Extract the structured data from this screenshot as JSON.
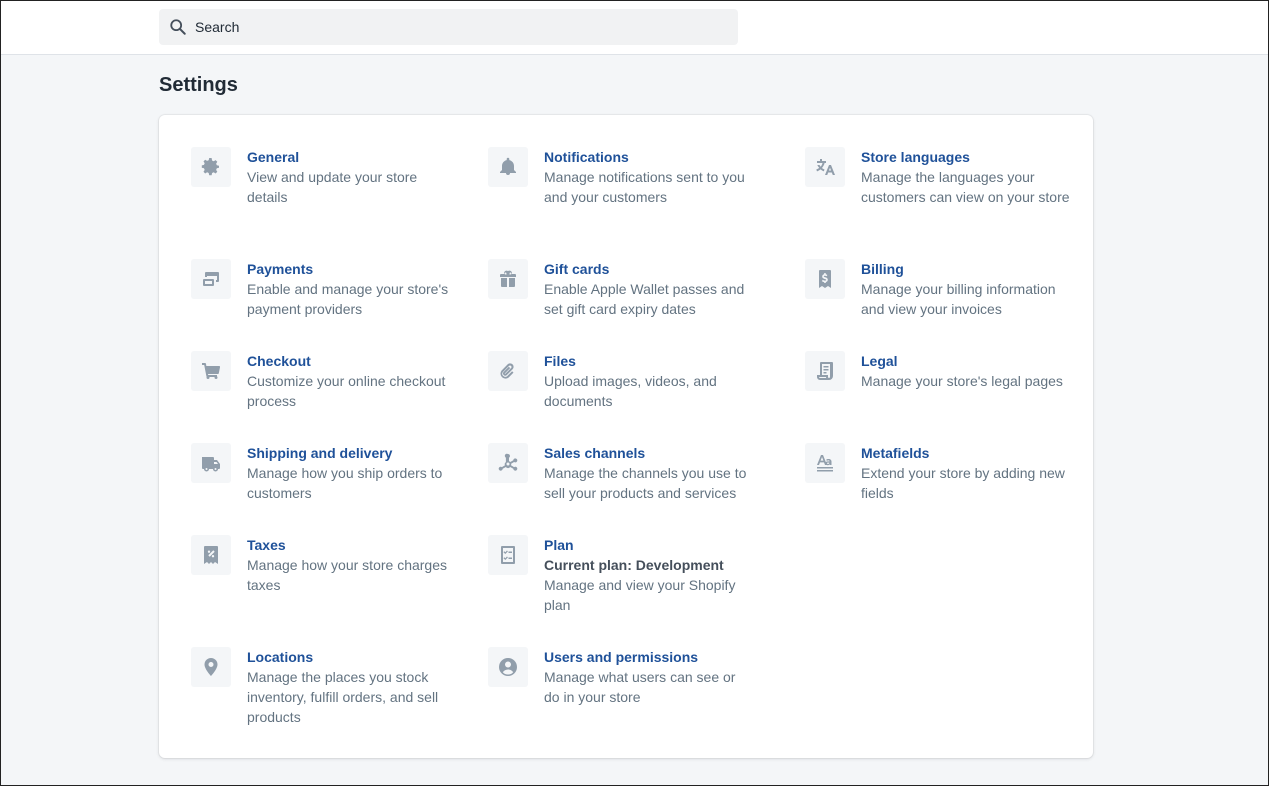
{
  "search": {
    "placeholder": "Search"
  },
  "page": {
    "title": "Settings"
  },
  "settings": [
    {
      "id": "general",
      "icon": "gear-icon",
      "title": "General",
      "description": "View and update your store details"
    },
    {
      "id": "notifications",
      "icon": "bell-icon",
      "title": "Notifications",
      "description": "Manage notifications sent to you and your customers"
    },
    {
      "id": "store-languages",
      "icon": "translate-icon",
      "title": "Store languages",
      "description": "Manage the languages your customers can view on your store"
    },
    {
      "id": "payments",
      "icon": "payment-icon",
      "title": "Payments",
      "description": "Enable and manage your store's payment providers"
    },
    {
      "id": "gift-cards",
      "icon": "gift-icon",
      "title": "Gift cards",
      "description": "Enable Apple Wallet passes and set gift card expiry dates"
    },
    {
      "id": "billing",
      "icon": "bill-dollar-icon",
      "title": "Billing",
      "description": "Manage your billing information and view your invoices"
    },
    {
      "id": "checkout",
      "icon": "cart-icon",
      "title": "Checkout",
      "description": "Customize your online checkout process"
    },
    {
      "id": "files",
      "icon": "paperclip-icon",
      "title": "Files",
      "description": "Upload images, videos, and documents"
    },
    {
      "id": "legal",
      "icon": "legal-document-icon",
      "title": "Legal",
      "description": "Manage your store's legal pages"
    },
    {
      "id": "shipping",
      "icon": "truck-icon",
      "title": "Shipping and delivery",
      "description": "Manage how you ship orders to customers"
    },
    {
      "id": "sales-channels",
      "icon": "channels-icon",
      "title": "Sales channels",
      "description": "Manage the channels you use to sell your products and services"
    },
    {
      "id": "metafields",
      "icon": "metafields-icon",
      "title": "Metafields",
      "description": "Extend your store by adding new fields"
    },
    {
      "id": "taxes",
      "icon": "tax-receipt-icon",
      "title": "Taxes",
      "description": "Manage how your store charges taxes"
    },
    {
      "id": "plan",
      "icon": "checklist-icon",
      "title": "Plan",
      "current_plan": "Current plan: Development",
      "description": "Manage and view your Shopify plan"
    },
    {
      "id": "locations",
      "icon": "location-pin-icon",
      "title": "Locations",
      "description": "Manage the places you stock inventory, fulfill orders, and sell products"
    },
    {
      "id": "users",
      "icon": "user-circle-icon",
      "title": "Users and permissions",
      "description": "Manage what users can see or do in your store"
    }
  ]
}
